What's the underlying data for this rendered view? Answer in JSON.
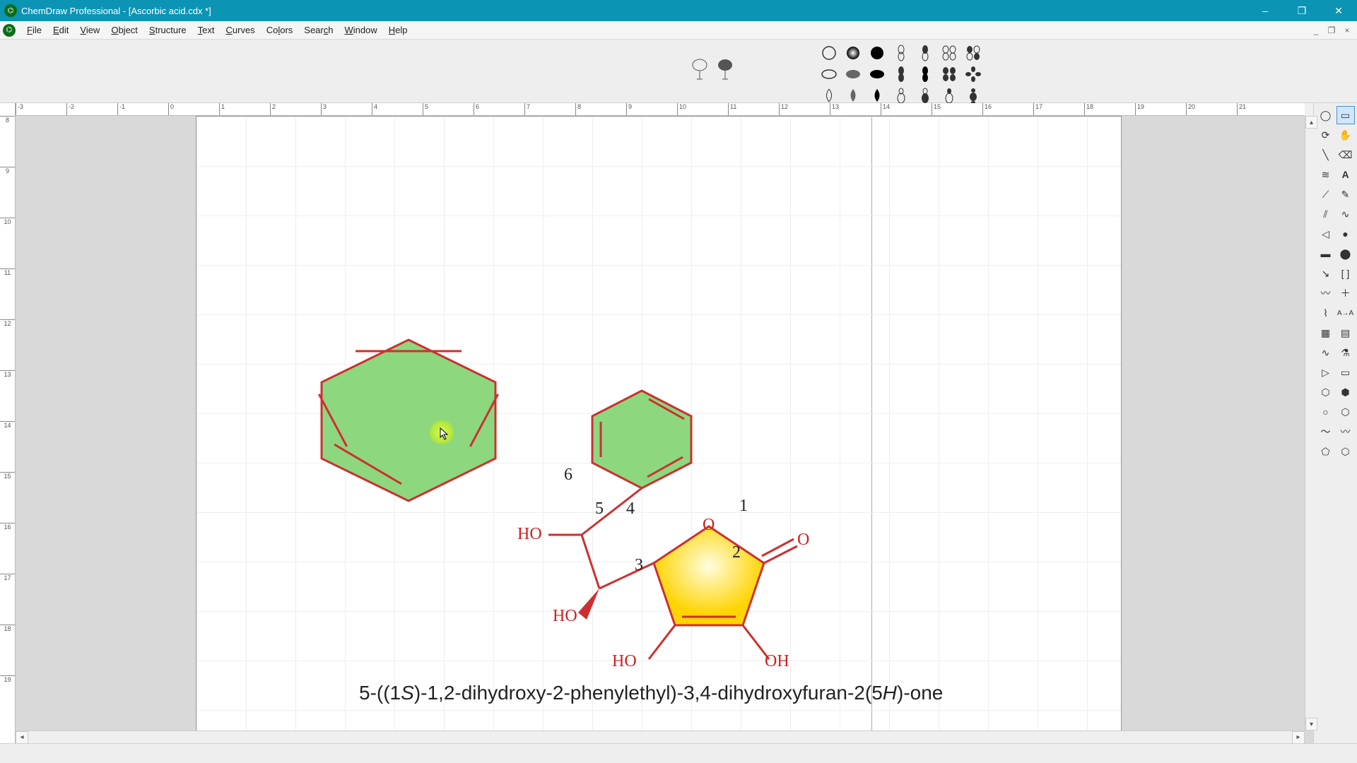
{
  "window": {
    "title": "ChemDraw Professional - [Ascorbic acid.cdx *]",
    "min": "–",
    "max": "❐",
    "close": "✕"
  },
  "menu": {
    "file": "File",
    "edit": "Edit",
    "view": "View",
    "object": "Object",
    "structure": "Structure",
    "text": "Text",
    "curves": "Curves",
    "colors": "Colors",
    "search": "Search",
    "window": "Window",
    "help": "Help"
  },
  "mdi": {
    "min": "_",
    "restore": "❐",
    "close": "×"
  },
  "ruler": {
    "h": [
      "-3",
      "-2",
      "-1",
      "0",
      "1",
      "2",
      "3",
      "4",
      "5",
      "6",
      "7",
      "8",
      "9",
      "10",
      "11",
      "12",
      "13",
      "14",
      "15",
      "16",
      "17",
      "18",
      "19",
      "20",
      "21"
    ],
    "v": [
      "8",
      "9",
      "10",
      "11",
      "12",
      "13",
      "14",
      "15",
      "16",
      "17",
      "18",
      "19"
    ]
  },
  "molecule": {
    "atoms": {
      "ho1": "HO",
      "ho2": "HO",
      "ho3": "HO",
      "oh": "OH",
      "o_top": "O",
      "o_dbl": "O"
    },
    "nums": {
      "n1": "1",
      "n2": "2",
      "n3": "3",
      "n4": "4",
      "n5": "5",
      "n6": "6"
    },
    "caption_pre": "5-((1",
    "caption_S": "S",
    "caption_mid": ")-1,2-dihydroxy-2-phenylethyl)-3,4-dihydroxyfuran-2(5",
    "caption_H": "H",
    "caption_post": ")-one"
  },
  "tools": {
    "lasso": "lasso",
    "marquee": "marquee",
    "rotate3d": "rotate3d",
    "hand": "hand",
    "solidbond": "solid-bond",
    "eraser": "eraser",
    "multbond": "multiple-bond",
    "text": "text-tool",
    "dashedbond": "dashed-bond",
    "pen": "pen",
    "hashbond": "hashed-bond",
    "chain": "chain",
    "wedge": "wedge-bond",
    "ball": "ball",
    "boldbond": "bold-bond",
    "filledball": "filled-ball",
    "arrow": "arrow",
    "bracket": "bracket",
    "wavy": "wavy-bond",
    "chemdraw": "chemdraw-icon",
    "plus": "plus",
    "grid": "grid",
    "table": "table",
    "zigzag": "zigzag",
    "flask": "flask",
    "play": "play",
    "rect": "rectangle",
    "hex1": "hexagon-flat",
    "hex2": "hexagon-point",
    "circ": "circle",
    "hex3": "hexagon-alt",
    "wave1": "wave",
    "wave2": "wave2",
    "pent": "pentagon",
    "hex4": "hexagon"
  }
}
